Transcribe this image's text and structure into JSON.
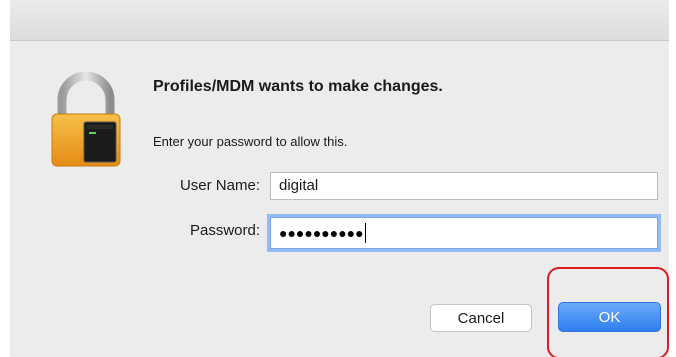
{
  "dialog": {
    "title": "Profiles/MDM wants to make changes.",
    "subtitle": "Enter your password to allow this.",
    "lock_icon": "lock-icon"
  },
  "form": {
    "username_label": "User Name:",
    "username_value": "digital",
    "password_label": "Password:",
    "password_mask": "●●●●●●●●●●"
  },
  "buttons": {
    "cancel_label": "Cancel",
    "ok_label": "OK"
  },
  "colors": {
    "accent": "#2f7ff0",
    "highlight": "#d81e1e",
    "lock_gold": "#f0a82a"
  }
}
